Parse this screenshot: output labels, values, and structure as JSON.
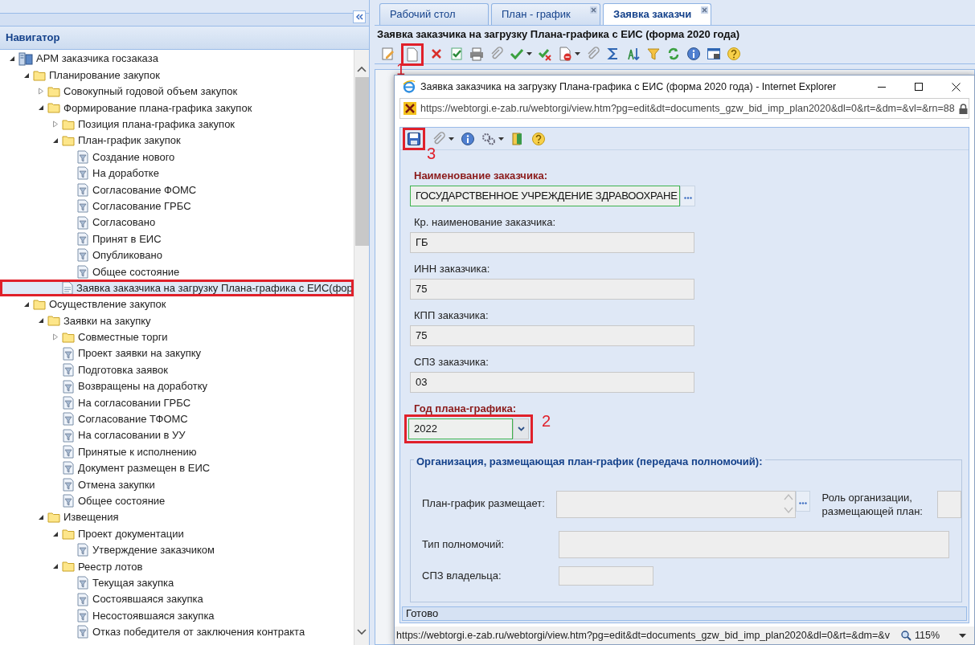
{
  "navigator": {
    "title": "Навигатор",
    "tree": [
      {
        "label": "АРМ заказчика госзаказа",
        "kind": "root",
        "expanded": true,
        "selected": false,
        "highlighted": false,
        "children": [
          {
            "label": "Планирование закупок",
            "kind": "folder",
            "expanded": true,
            "selected": false,
            "highlighted": false,
            "children": [
              {
                "label": "Совокупный годовой объем закупок",
                "kind": "folder",
                "expanded": false,
                "selected": false,
                "highlighted": false
              },
              {
                "label": "Формирование плана-графика закупок",
                "kind": "folder",
                "expanded": true,
                "selected": false,
                "highlighted": false,
                "children": [
                  {
                    "label": "Позиция плана-графика закупок",
                    "kind": "folder",
                    "expanded": false,
                    "selected": false,
                    "highlighted": false
                  },
                  {
                    "label": "План-график закупок",
                    "kind": "folder",
                    "expanded": true,
                    "selected": false,
                    "highlighted": false,
                    "children": [
                      {
                        "label": "Создание нового",
                        "kind": "filter",
                        "selected": false,
                        "highlighted": false
                      },
                      {
                        "label": "На доработке",
                        "kind": "filter",
                        "selected": false,
                        "highlighted": false
                      },
                      {
                        "label": "Согласование ФОМС",
                        "kind": "filter",
                        "selected": false,
                        "highlighted": false
                      },
                      {
                        "label": "Согласование ГРБС",
                        "kind": "filter",
                        "selected": false,
                        "highlighted": false
                      },
                      {
                        "label": "Согласовано",
                        "kind": "filter",
                        "selected": false,
                        "highlighted": false
                      },
                      {
                        "label": "Принят в ЕИС",
                        "kind": "filter",
                        "selected": false,
                        "highlighted": false
                      },
                      {
                        "label": "Опубликовано",
                        "kind": "filter",
                        "selected": false,
                        "highlighted": false
                      },
                      {
                        "label": "Общее состояние",
                        "kind": "filter",
                        "selected": false,
                        "highlighted": false
                      }
                    ]
                  },
                  {
                    "label": "Заявка заказчика на загрузку Плана-графика с ЕИС(фор",
                    "kind": "document",
                    "selected": true,
                    "highlighted": true
                  }
                ]
              }
            ]
          },
          {
            "label": "Осуществление закупок",
            "kind": "folder",
            "expanded": true,
            "selected": false,
            "highlighted": false,
            "children": [
              {
                "label": "Заявки на закупку",
                "kind": "folder",
                "expanded": true,
                "selected": false,
                "highlighted": false,
                "children": [
                  {
                    "label": "Совместные торги",
                    "kind": "folder",
                    "expanded": false,
                    "selected": false,
                    "highlighted": false
                  },
                  {
                    "label": "Проект заявки на закупку",
                    "kind": "filter",
                    "selected": false,
                    "highlighted": false
                  },
                  {
                    "label": "Подготовка заявок",
                    "kind": "filter",
                    "selected": false,
                    "highlighted": false
                  },
                  {
                    "label": "Возвращены на доработку",
                    "kind": "filter",
                    "selected": false,
                    "highlighted": false
                  },
                  {
                    "label": "На согласовании ГРБС",
                    "kind": "filter",
                    "selected": false,
                    "highlighted": false
                  },
                  {
                    "label": "Согласование ТФОМС",
                    "kind": "filter",
                    "selected": false,
                    "highlighted": false
                  },
                  {
                    "label": "На согласовании в УУ",
                    "kind": "filter",
                    "selected": false,
                    "highlighted": false
                  },
                  {
                    "label": "Принятые к исполнению",
                    "kind": "filter",
                    "selected": false,
                    "highlighted": false
                  },
                  {
                    "label": "Документ размещен в ЕИС",
                    "kind": "filter",
                    "selected": false,
                    "highlighted": false
                  },
                  {
                    "label": "Отмена закупки",
                    "kind": "filter",
                    "selected": false,
                    "highlighted": false
                  },
                  {
                    "label": "Общее состояние",
                    "kind": "filter",
                    "selected": false,
                    "highlighted": false
                  }
                ]
              },
              {
                "label": "Извещения",
                "kind": "folder",
                "expanded": true,
                "selected": false,
                "highlighted": false,
                "children": [
                  {
                    "label": "Проект документации",
                    "kind": "folder",
                    "expanded": true,
                    "selected": false,
                    "highlighted": false,
                    "children": [
                      {
                        "label": "Утверждение заказчиком",
                        "kind": "filter",
                        "selected": false,
                        "highlighted": false
                      }
                    ]
                  },
                  {
                    "label": "Реестр лотов",
                    "kind": "folder",
                    "expanded": true,
                    "selected": false,
                    "highlighted": false,
                    "children": [
                      {
                        "label": "Текущая закупка",
                        "kind": "filter",
                        "selected": false,
                        "highlighted": false
                      },
                      {
                        "label": "Состоявшаяся закупка",
                        "kind": "filter",
                        "selected": false,
                        "highlighted": false
                      },
                      {
                        "label": "Несостоявшаяся закупка",
                        "kind": "filter",
                        "selected": false,
                        "highlighted": false
                      },
                      {
                        "label": "Отказ победителя от заключения контракта",
                        "kind": "filter",
                        "selected": false,
                        "highlighted": false
                      }
                    ]
                  }
                ]
              }
            ]
          }
        ]
      }
    ]
  },
  "tabs": [
    {
      "label": "Рабочий стол",
      "selected": false,
      "closable": false
    },
    {
      "label": "План - график",
      "selected": false,
      "closable": true
    },
    {
      "label": "Заявка заказчи",
      "selected": true,
      "closable": true
    }
  ],
  "page_title": "Заявка заказчика на загрузку Плана-графика с ЕИС (форма 2020 года)",
  "popup": {
    "title": "Заявка заказчика на загрузку Плана-графика с ЕИС (форма 2020 года) - Internet Explorer",
    "address": "https://webtorgi.e-zab.ru/webtorgi/view.htm?pg=edit&dt=documents_gzw_bid_imp_plan2020&dl=0&rt=&dm=&vl=&rn=88",
    "fields": [
      {
        "label": "Наименование заказчика:",
        "value": "ГОСУДАРСТВЕННОЕ УЧРЕЖДЕНИЕ ЗДРАВООХРАНЕ",
        "kind": "lookup",
        "required": true,
        "editable": true
      },
      {
        "label": "Кр. наименование заказчика:",
        "value": "ГБ",
        "kind": "text",
        "required": false,
        "editable": false
      },
      {
        "label": "ИНН заказчика:",
        "value": "75",
        "kind": "text",
        "required": false,
        "editable": false
      },
      {
        "label": "КПП заказчика:",
        "value": "75",
        "kind": "text",
        "required": false,
        "editable": false
      },
      {
        "label": "СПЗ заказчика:",
        "value": "03",
        "kind": "text",
        "required": false,
        "editable": false
      },
      {
        "label": "Год плана-графика:",
        "value": "2022",
        "kind": "select",
        "required": true,
        "editable": true
      }
    ],
    "group": {
      "legend": "Организация, размещающая план-график (передача полномочий):",
      "plan_placer": {
        "label": "План-график размещает:"
      },
      "role": {
        "label": "Роль организации, размещающей план:"
      },
      "authority_type": {
        "label": "Тип полномочий:"
      },
      "owner_spz": {
        "label": "СПЗ владельца:"
      }
    },
    "status": "Готово",
    "status_url": "https://webtorgi.e-zab.ru/webtorgi/view.htm?pg=edit&dt=documents_gzw_bid_imp_plan2020&dl=0&rt=&dm=&v",
    "zoom": "115%"
  },
  "annotations": [
    {
      "label": "1"
    },
    {
      "label": "2"
    },
    {
      "label": "3"
    }
  ]
}
